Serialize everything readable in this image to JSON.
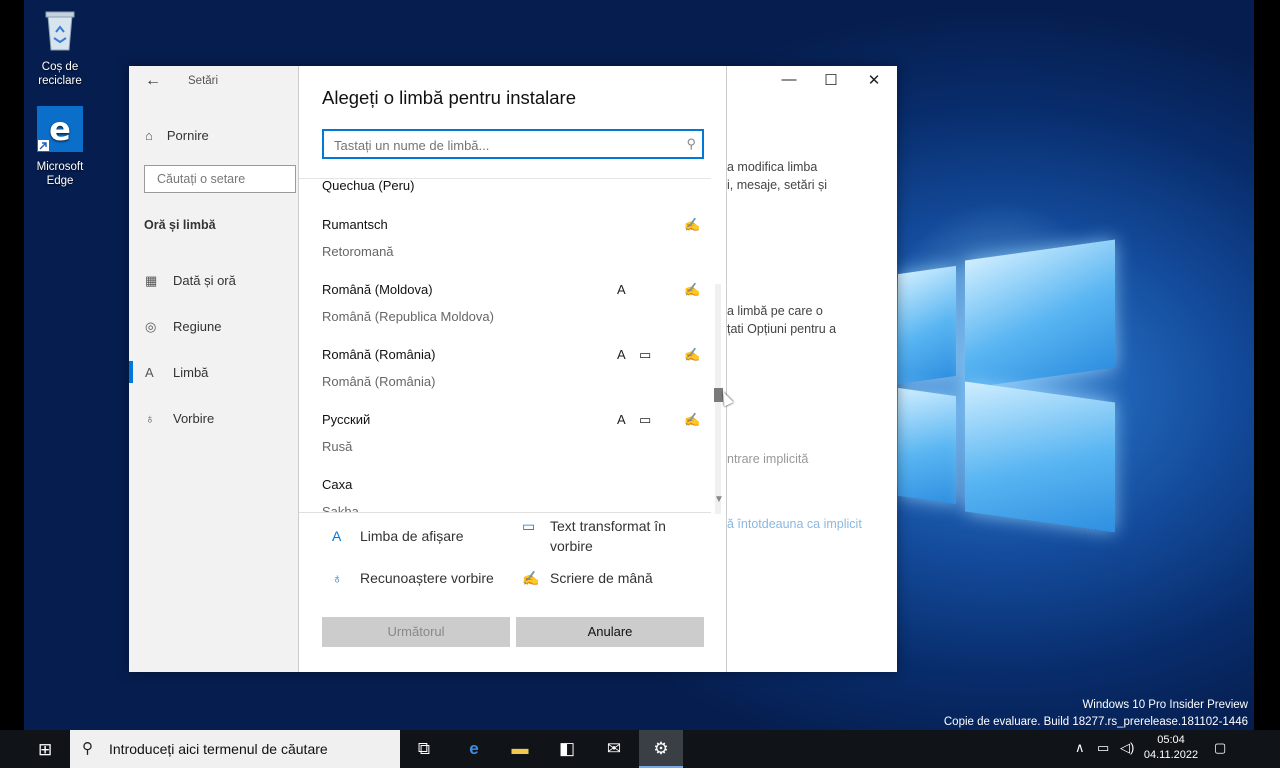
{
  "desktop": {
    "icons": [
      {
        "label": "Coș de reciclare"
      },
      {
        "label": "Microsoft Edge"
      }
    ],
    "watermark": {
      "line1": "Windows 10 Pro Insider Preview",
      "line2": "Copie de evaluare. Build 18277.rs_prerelease.181102-1446"
    }
  },
  "settings": {
    "app_title": "Setări",
    "home": "Pornire",
    "search_placeholder": "Căutați o setare",
    "section": "Oră și limbă",
    "nav": [
      {
        "label": "Dată și oră",
        "icon": "calendar-icon"
      },
      {
        "label": "Regiune",
        "icon": "globe-icon"
      },
      {
        "label": "Limbă",
        "icon": "language-icon"
      },
      {
        "label": "Vorbire",
        "icon": "microphone-icon"
      }
    ],
    "right_text": {
      "p1": "a modifica limba\ni, mesaje, setări și",
      "p2": "a limbă pe care o\nțati Opțiuni pentru a",
      "p3": "ntrare implicită",
      "p4": "ă întotdeauna ca implicit"
    }
  },
  "dialog": {
    "title": "Alegeți o limbă pentru instalare",
    "search_placeholder": "Tastați un nume de limbă...",
    "languages": [
      {
        "name": "Quechua (Peru)",
        "sub": "",
        "display": false,
        "tts": false,
        "handwriting": false
      },
      {
        "name": "Rumantsch",
        "sub": "Retoromană",
        "display": false,
        "tts": false,
        "handwriting": true
      },
      {
        "name": "Română (Moldova)",
        "sub": "Română (Republica Moldova)",
        "display": true,
        "tts": false,
        "handwriting": true
      },
      {
        "name": "Română (România)",
        "sub": "Română (România)",
        "display": true,
        "tts": true,
        "handwriting": true
      },
      {
        "name": "Русский",
        "sub": "Rusă",
        "display": true,
        "tts": true,
        "handwriting": true
      },
      {
        "name": "Caxa",
        "sub": "Sakha",
        "display": false,
        "tts": false,
        "handwriting": false
      }
    ],
    "legend": {
      "display": "Limba de afișare",
      "tts": "Text transformat în vorbire",
      "speech": "Recunoaștere vorbire",
      "handwriting": "Scriere de mână"
    },
    "next_label": "Următorul",
    "cancel_label": "Anulare"
  },
  "taskbar": {
    "search_text": "Introduceți aici termenul de căutare",
    "time": "05:04",
    "date": "04.11.2022"
  },
  "colors": {
    "accent": "#0078d7",
    "taskbar": "#101418"
  }
}
